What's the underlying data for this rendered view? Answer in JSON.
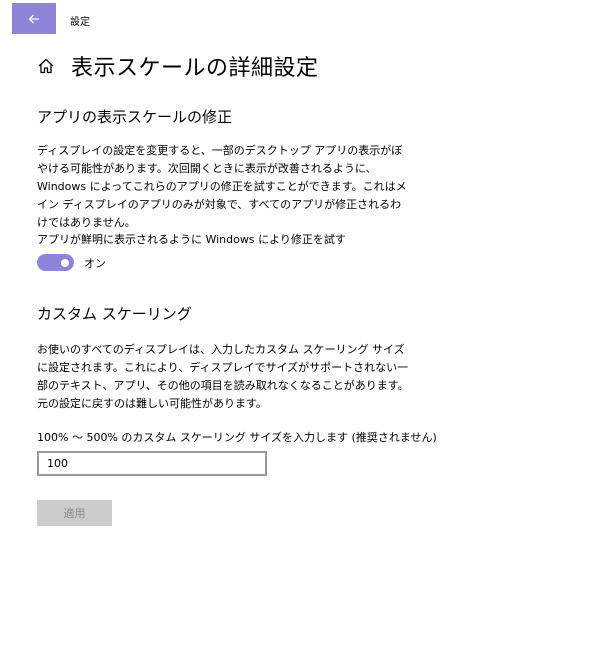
{
  "window": {
    "title": "設定"
  },
  "header": {
    "title": "表示スケールの詳細設定"
  },
  "fix_section": {
    "title": "アプリの表示スケールの修正",
    "description": "ディスプレイの設定を変更すると、一部のデスクトップ アプリの表示がぼやける可能性があります。次回開くときに表示が改善されるように、Windows によってこれらのアプリの修正を試すことができます。これはメイン ディスプレイのアプリのみが対象で、すべてのアプリが修正されるわけではありません。",
    "toggle_label": "アプリが鮮明に表示されるように Windows により修正を試す",
    "toggle_state": "オン",
    "toggle_on": true
  },
  "custom_section": {
    "title": "カスタム スケーリング",
    "description": "お使いのすべてのディスプレイは、入力したカスタム スケーリング サイズに設定されます。これにより、ディスプレイでサイズがサポートされない一部のテキスト、アプリ、その他の項目を読み取れなくなることがあります。元の設定に戻すのは難しい可能性があります。",
    "input_label": "100% 〜 500% のカスタム スケーリング サイズを入力します (推奨されません)",
    "input_value": "100",
    "apply_label": "適用"
  },
  "colors": {
    "accent": "#8c84d9",
    "disabled_button": "#cccccc",
    "disabled_text": "#8a8a8a"
  },
  "icons": {
    "back": "back-arrow-icon",
    "home": "home-icon"
  }
}
